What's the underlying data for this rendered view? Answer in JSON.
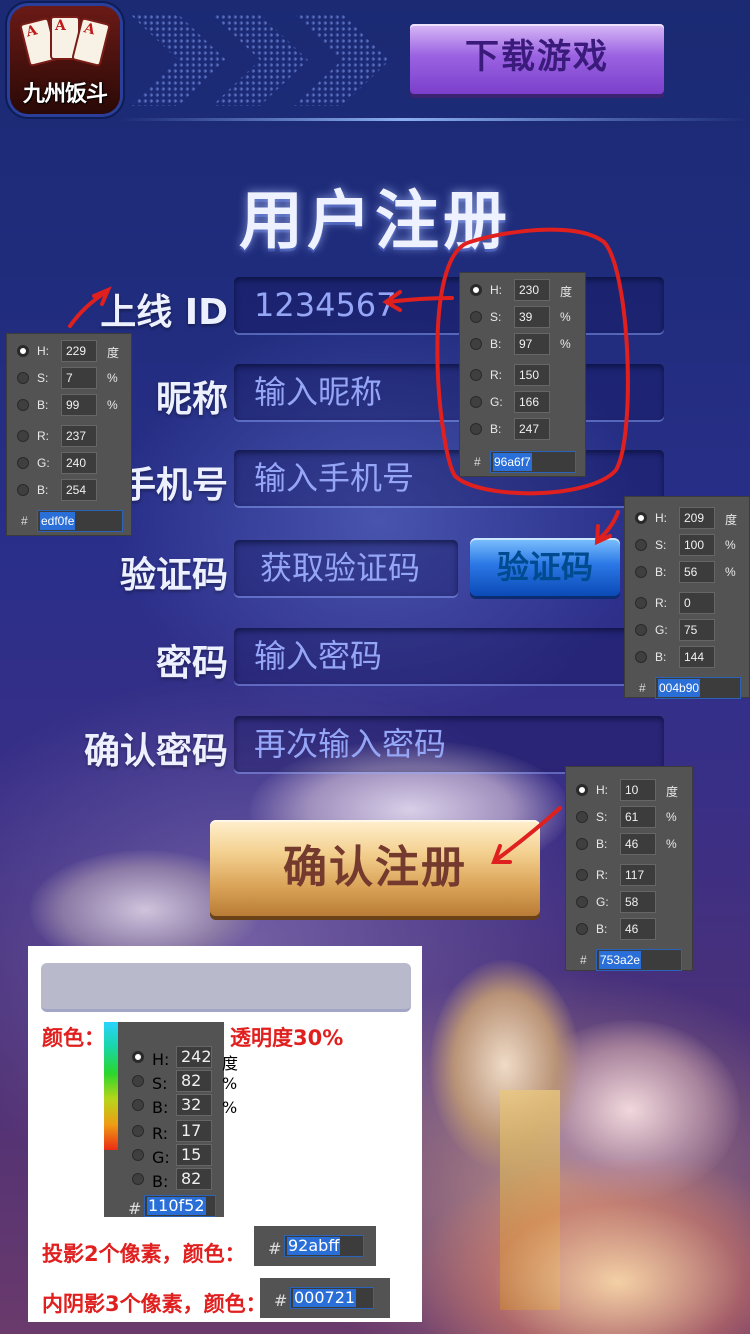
{
  "header": {
    "logo_text": "九州饭斗",
    "download_button": "下载游戏"
  },
  "title": "用户注册",
  "form": {
    "fields": [
      {
        "label": "上线 ID",
        "value": "1234567"
      },
      {
        "label": "昵称",
        "placeholder": "输入昵称"
      },
      {
        "label": "手机号",
        "placeholder": "输入手机号"
      },
      {
        "label": "验证码",
        "placeholder": "获取验证码",
        "button": "验证码"
      },
      {
        "label": "密码",
        "placeholder": "输入密码"
      },
      {
        "label": "确认密码",
        "placeholder": "再次输入密码"
      }
    ],
    "submit": "确认注册"
  },
  "pickers": [
    {
      "name": "label-color",
      "H": "229",
      "S": "7",
      "B": "99",
      "R": "237",
      "G": "240",
      "Bv": "254",
      "hex": "edf0fe",
      "unit_h": "度"
    },
    {
      "name": "value-color",
      "H": "230",
      "S": "39",
      "B": "97",
      "R": "150",
      "G": "166",
      "Bv": "247",
      "hex": "96a6f7",
      "unit_h": "度"
    },
    {
      "name": "sms-button-color",
      "H": "209",
      "S": "100",
      "B": "56",
      "R": "0",
      "G": "75",
      "Bv": "144",
      "hex": "004b90",
      "unit_h": "度"
    },
    {
      "name": "submit-button-color",
      "H": "10",
      "S": "61",
      "B": "46",
      "R": "117",
      "G": "58",
      "Bv": "46",
      "hex": "753a2e",
      "unit_h": "度"
    },
    {
      "name": "field-bg-color",
      "H": "242",
      "S": "82",
      "B": "32",
      "R": "17",
      "G": "15",
      "Bv": "82",
      "hex": "110f52",
      "unit_h": "度"
    }
  ],
  "spec": {
    "color_label": "颜色：",
    "opacity_label": "透明度30%",
    "shadow_label": "投影2个像素，颜色：",
    "shadow_hex": "92abff",
    "inner_shadow_label": "内阴影3个像素，颜色：",
    "inner_shadow_hex": "000721"
  },
  "colors": {
    "label": "#edf0fe",
    "value_text": "#96a6f7",
    "sms_button_text": "#004b90",
    "submit_text": "#753a2e",
    "field_bg": "#110f52",
    "field_shadow": "#92abff",
    "field_inner_shadow": "#000721",
    "annotation": "#e0201f"
  }
}
